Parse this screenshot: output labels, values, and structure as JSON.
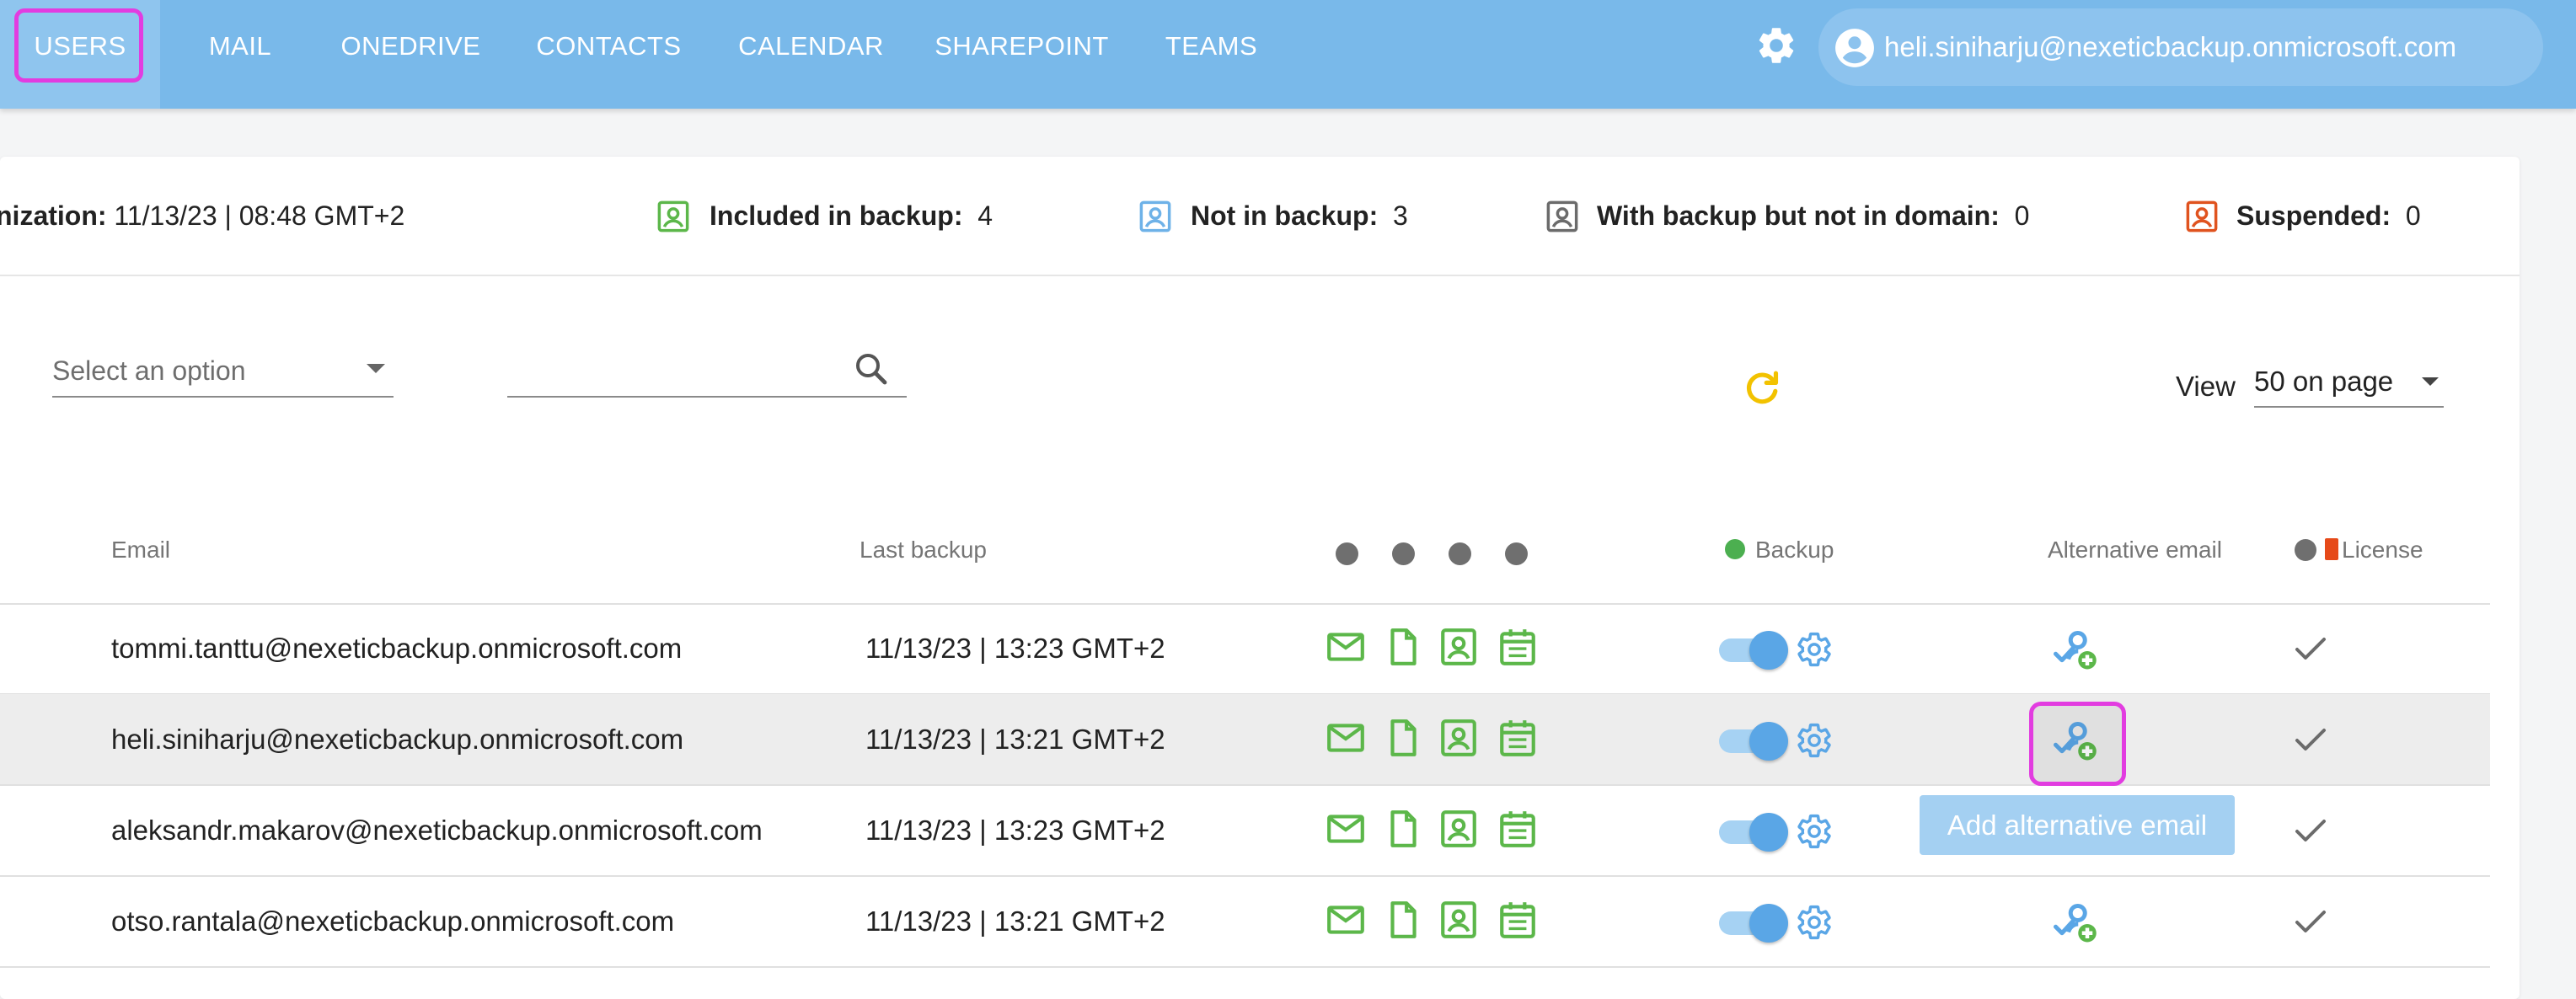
{
  "nav": {
    "items": [
      {
        "label": "USERS",
        "active": true
      },
      {
        "label": "MAIL"
      },
      {
        "label": "ONEDRIVE"
      },
      {
        "label": "CONTACTS"
      },
      {
        "label": "CALENDAR"
      },
      {
        "label": "SHAREPOINT"
      },
      {
        "label": "TEAMS"
      }
    ],
    "account_email": "heli.siniharju@nexeticbackup.onmicrosoft.com",
    "icons": {
      "settings": "gear-icon",
      "account": "account-circle-icon"
    }
  },
  "stats": {
    "sync_label": "nization:",
    "sync_value": "11/13/23 | 08:48 GMT+2",
    "included_label": "Included in backup:",
    "included_value": "4",
    "not_in_label": "Not in backup:",
    "not_in_value": "3",
    "with_backup_label": "With backup but not in domain:",
    "with_backup_value": "0",
    "suspended_label": "Suspended:",
    "suspended_value": "0"
  },
  "filters": {
    "select_placeholder": "Select an option",
    "search_value": "",
    "view_label": "View",
    "view_value": "50 on page"
  },
  "table": {
    "headers": {
      "email": "Email",
      "last_backup": "Last backup",
      "backup": "Backup",
      "alternative_email": "Alternative email",
      "license": "License"
    },
    "rows": [
      {
        "email": "tommi.tanttu@nexeticbackup.onmicrosoft.com",
        "last_backup": "11/13/23 | 13:23 GMT+2",
        "backup_enabled": true,
        "licensed": true
      },
      {
        "email": "heli.siniharju@nexeticbackup.onmicrosoft.com",
        "last_backup": "11/13/23 | 13:21 GMT+2",
        "backup_enabled": true,
        "licensed": true,
        "selected": true
      },
      {
        "email": "aleksandr.makarov@nexeticbackup.onmicrosoft.com",
        "last_backup": "11/13/23 | 13:23 GMT+2",
        "backup_enabled": true,
        "licensed": true
      },
      {
        "email": "otso.rantala@nexeticbackup.onmicrosoft.com",
        "last_backup": "11/13/23 | 13:21 GMT+2",
        "backup_enabled": true,
        "licensed": true
      }
    ]
  },
  "tooltip": "Add alternative email",
  "colors": {
    "nav_bg": "#79b9ea",
    "service_green": "#5cb74a",
    "accent_blue": "#5aa6e6",
    "highlight_magenta": "#e23ce0",
    "refresh_yellow": "#f2c200"
  }
}
